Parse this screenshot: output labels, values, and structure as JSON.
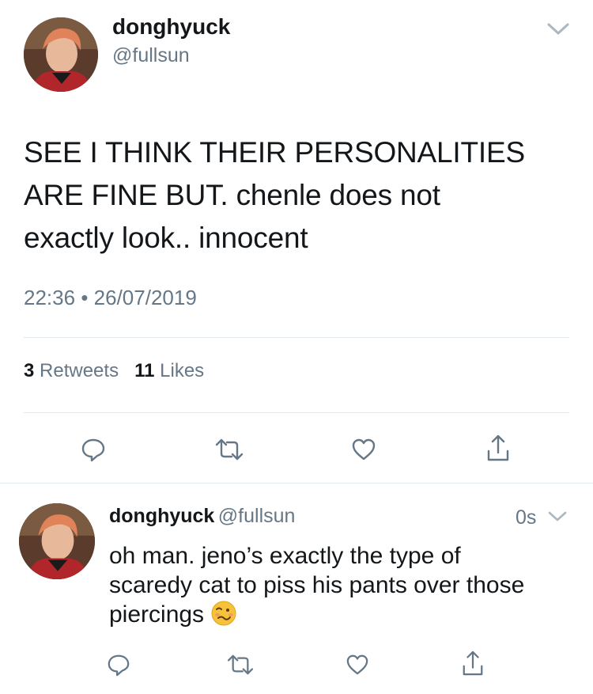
{
  "main_tweet": {
    "display_name": "donghyuck",
    "handle": "@fullsun",
    "text_lines": [
      "SEE I THINK THEIR PERSONALITIES",
      "ARE FINE BUT. chenle does not",
      "exactly look.. innocent"
    ],
    "time": "22:36",
    "separator": "•",
    "date": "26/07/2019",
    "retweet_count": "3",
    "retweet_label": "Retweets",
    "like_count": "11",
    "like_label": "Likes",
    "menu_icon": "chevron-down-icon"
  },
  "reply": {
    "display_name": "donghyuck",
    "handle": "@fullsun",
    "timestamp": "0s",
    "text_lines": [
      "oh man. jeno’s exactly the type of",
      "scaredy cat to piss his pants over those",
      "piercings"
    ],
    "emoji": "🥴",
    "menu_icon": "chevron-down-icon"
  },
  "actions": {
    "icons": [
      "reply-icon",
      "retweet-icon",
      "like-icon",
      "share-icon"
    ]
  },
  "colors": {
    "text_primary": "#14171a",
    "text_secondary": "#657786",
    "divider": "#e1e8ed"
  }
}
